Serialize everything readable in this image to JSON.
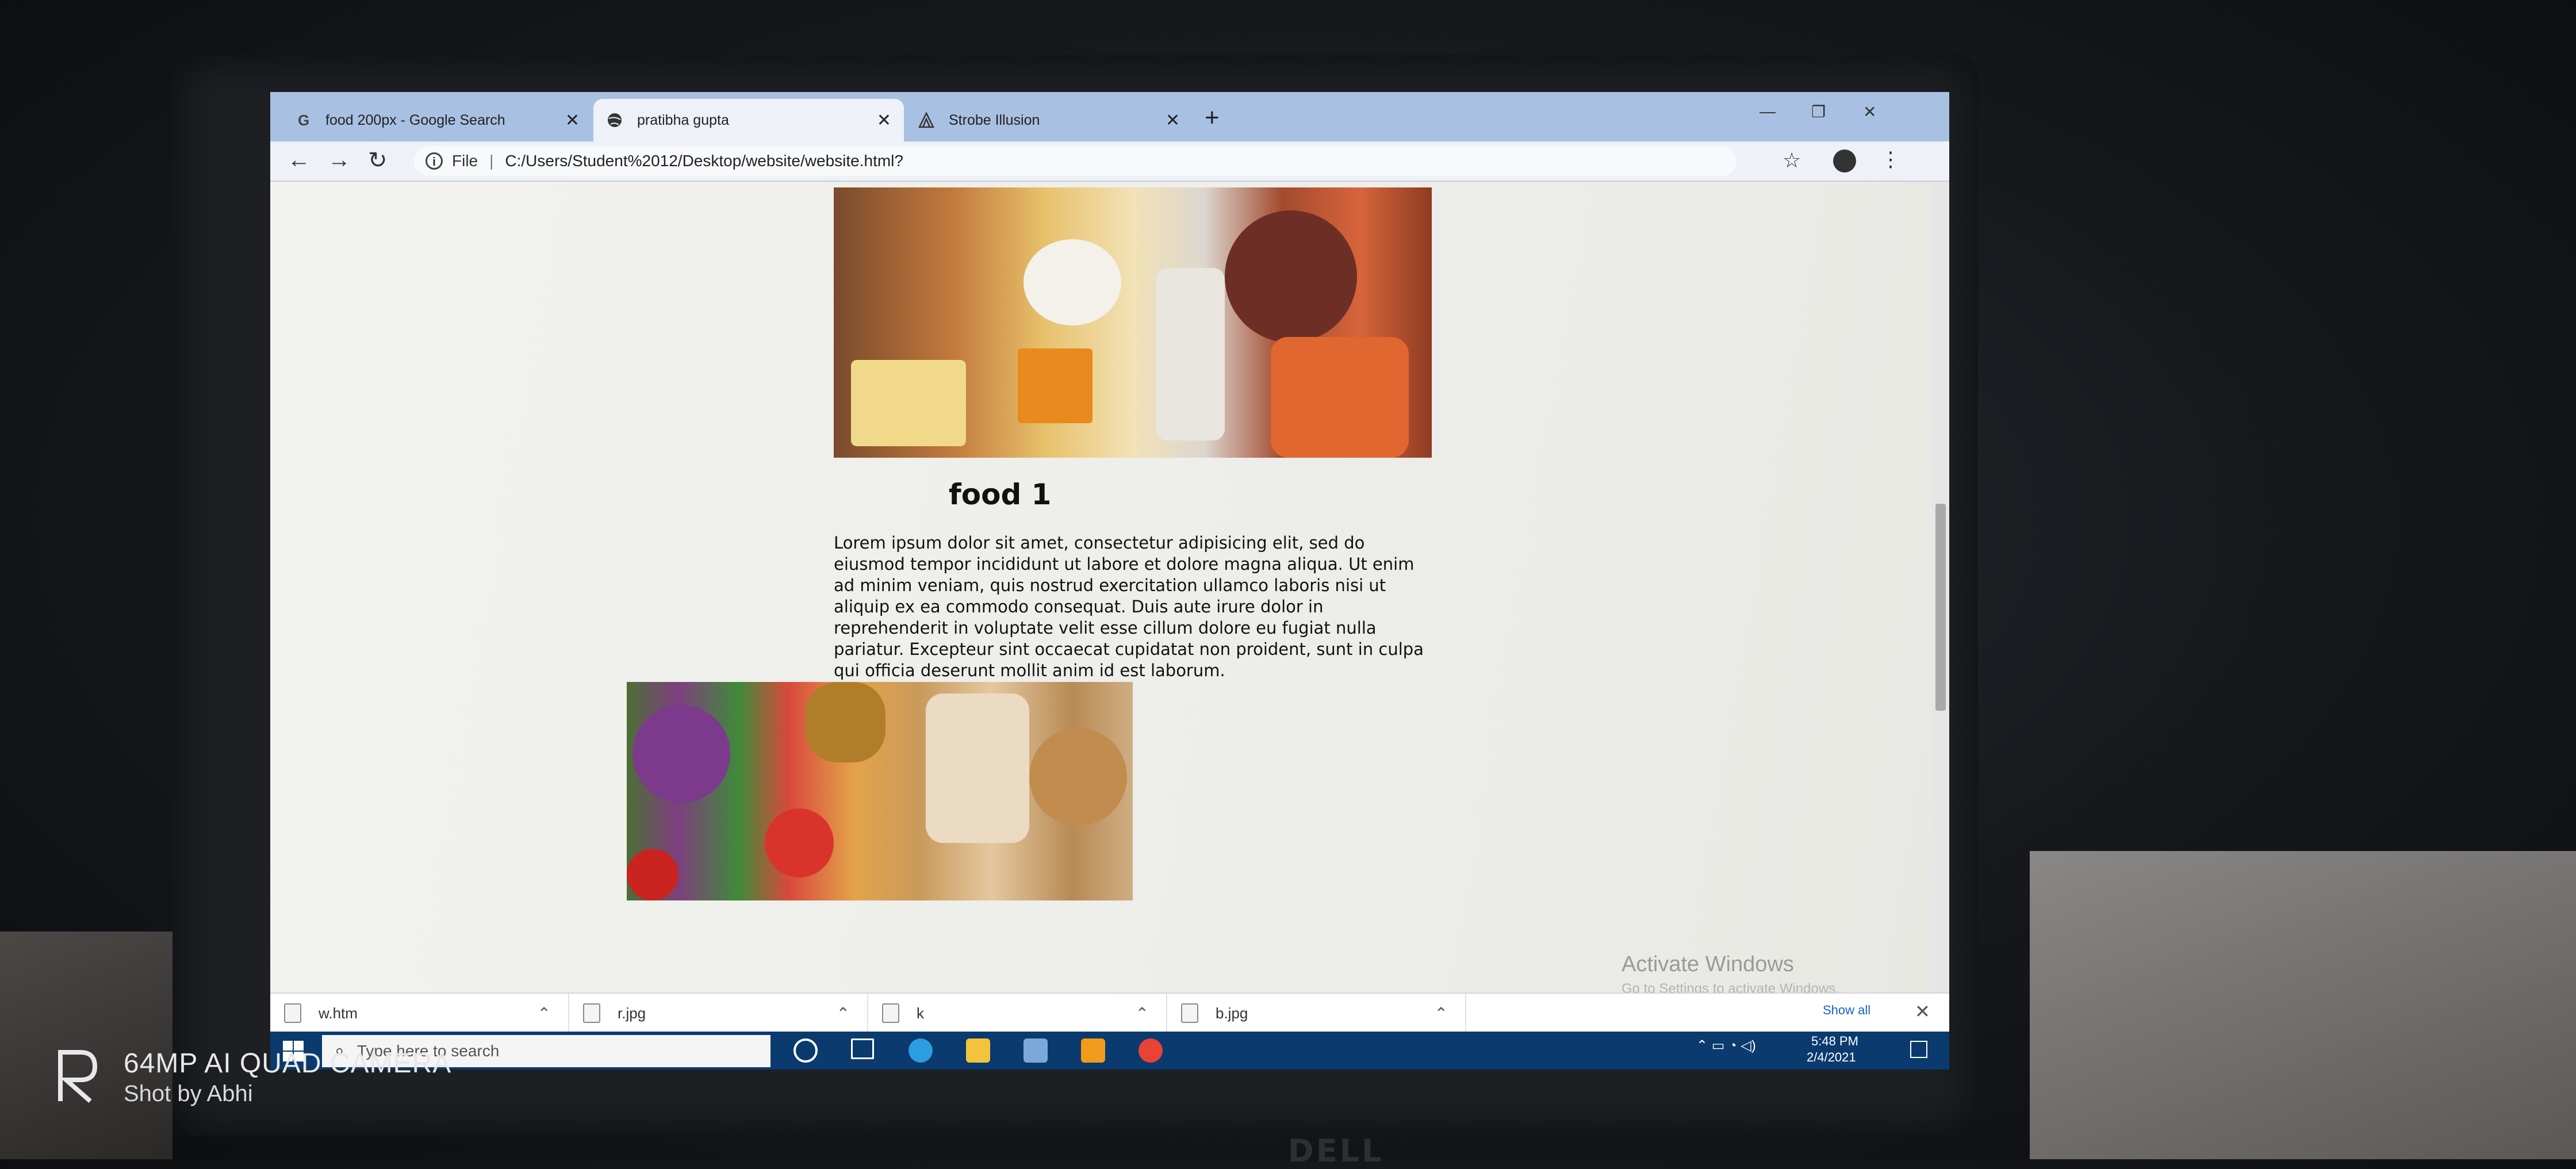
{
  "browser": {
    "tabs": [
      {
        "label": "food 200px - Google Search",
        "favicon": "google-icon"
      },
      {
        "label": "pratibha gupta",
        "favicon": "globe-icon"
      },
      {
        "label": "Strobe Illusion",
        "favicon": "strobe-icon"
      }
    ],
    "address": {
      "info_label": "i",
      "scheme_label": "File",
      "url": "C:/Users/Student%2012/Desktop/website/website.html?"
    }
  },
  "page": {
    "section_title": "food 1",
    "section_text": "Lorem ipsum dolor sit amet, consectetur adipisicing elit, sed do eiusmod tempor incididunt ut labore et dolore magna aliqua. Ut enim ad minim veniam, quis nostrud exercitation ullamco laboris nisi ut aliquip ex ea commodo consequat. Duis aute irure dolor in reprehenderit in voluptate velit esse cillum dolore eu fugiat nulla pariatur. Excepteur sint occaecat cupidatat non proident, sunt in culpa qui officia deserunt mollit anim id est laborum."
  },
  "windows_watermark": {
    "title": "Activate Windows",
    "subtitle": "Go to Settings to activate Windows."
  },
  "downloads": {
    "items": [
      {
        "name": "w.htm"
      },
      {
        "name": "r.jpg"
      },
      {
        "name": "k"
      },
      {
        "name": "b.jpg"
      }
    ],
    "show_all": "Show all"
  },
  "taskbar": {
    "search_placeholder": "Type here to search",
    "time": "5:48 PM",
    "date": "2/4/2021"
  },
  "camera_watermark": {
    "line1": "64MP AI QUAD CAMERA",
    "line2": "Shot by Abhi"
  },
  "bezel": {
    "brand": "DELL"
  },
  "colors": {
    "tabstrip": "#a8c0e2",
    "taskbar": "#0a3a6e",
    "link": "#1a62c7"
  }
}
